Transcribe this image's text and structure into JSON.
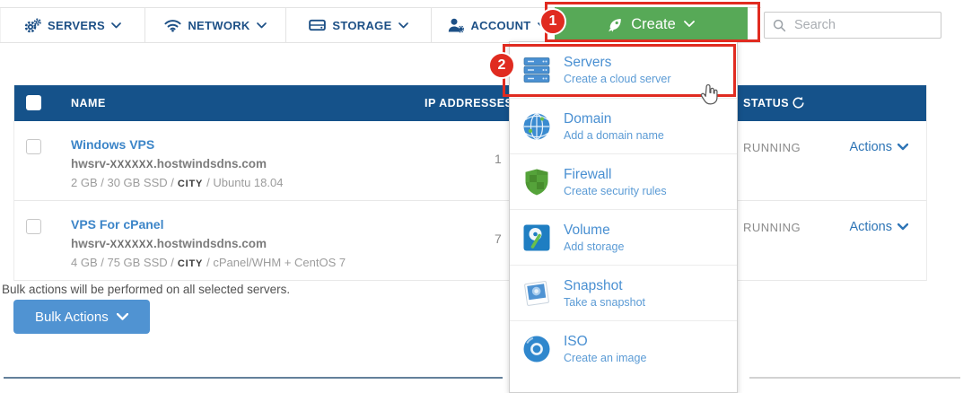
{
  "nav": {
    "items": [
      {
        "label": "SERVERS"
      },
      {
        "label": "NETWORK"
      },
      {
        "label": "STORAGE"
      },
      {
        "label": "ACCOUNT"
      }
    ],
    "create_label": "Create",
    "search_placeholder": "Search"
  },
  "annotations": {
    "step1": "1",
    "step2": "2"
  },
  "dropdown": {
    "items": [
      {
        "title": "Servers",
        "subtitle": "Create a cloud server"
      },
      {
        "title": "Domain",
        "subtitle": "Add a domain name"
      },
      {
        "title": "Firewall",
        "subtitle": "Create security rules"
      },
      {
        "title": "Volume",
        "subtitle": "Add storage"
      },
      {
        "title": "Snapshot",
        "subtitle": "Take a snapshot"
      },
      {
        "title": "ISO",
        "subtitle": "Create an image"
      }
    ]
  },
  "table": {
    "header": {
      "name": "NAME",
      "ip": "IP ADDRESSES",
      "status": "STATUS"
    },
    "rows": [
      {
        "name": "Windows VPS",
        "host_prefix": "hwsrv-",
        "host_redacted": "XXXXXX",
        "host_suffix": ".hostwindsdns.com",
        "specs_prefix": "2 GB / 30 GB SSD /",
        "city": "CITY",
        "specs_suffix": "/ Ubuntu 18.04",
        "ip_visible": "1",
        "status": "RUNNING",
        "actions_label": "Actions"
      },
      {
        "name": "VPS For cPanel",
        "host_prefix": "hwsrv-",
        "host_redacted": "XXXXXX",
        "host_suffix": ".hostwindsdns.com",
        "specs_prefix": "4 GB / 75 GB SSD /",
        "city": "CITY",
        "specs_suffix": "/ cPanel/WHM + CentOS 7",
        "ip_visible": "7",
        "status": "RUNNING",
        "actions_label": "Actions"
      }
    ]
  },
  "bulk": {
    "note": "Bulk actions will be performed on all selected servers.",
    "button_label": "Bulk Actions"
  },
  "colors": {
    "accent_red": "#e02b20",
    "create_green": "#57a957",
    "header_blue": "#15528a",
    "link_blue": "#3c85c8",
    "menu_blue": "#4a90d2",
    "bulk_blue": "#5093d2"
  }
}
